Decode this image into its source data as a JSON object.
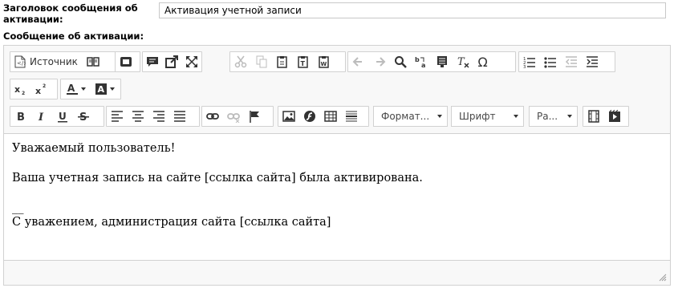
{
  "form": {
    "subject_label_line1": "Заголовок сообщения об",
    "subject_label_line2": "активации:",
    "subject_value": "Активация учетной записи",
    "message_label": "Сообщение об активации:"
  },
  "toolbar": {
    "source_label": "Источник",
    "format_label": "Формат...",
    "font_label": "Шрифт",
    "size_label": "Ра..."
  },
  "content": {
    "line1": "Уважаемый пользователь!",
    "line2": "Ваша учетная запись на сайте [ссылка сайта] была активирована.",
    "line3": "__",
    "line4": "С уважением, администрация сайта [ссылка сайта]"
  },
  "colors": {
    "toolbar_bg": "#f8f8f8",
    "border": "#d1d1d1",
    "icon": "#333333",
    "disabled_icon": "#bcbcbc"
  }
}
